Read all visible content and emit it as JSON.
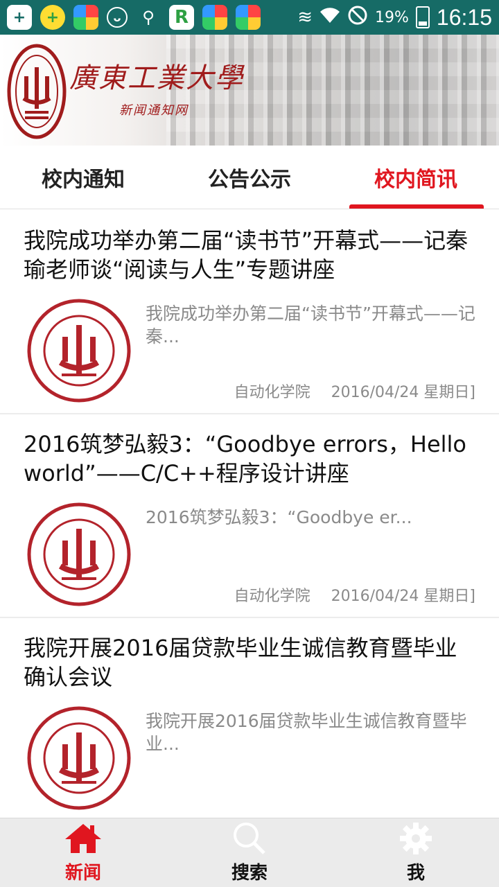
{
  "status_bar": {
    "battery": "19%",
    "time": "16:15",
    "icons": [
      "plus-box-icon",
      "add-icon",
      "app-icon",
      "face-icon",
      "usb-icon",
      "r-app-icon",
      "app-icon",
      "app-icon",
      "vibrate-icon",
      "wifi-icon",
      "no-sign-icon",
      "battery-icon"
    ]
  },
  "header": {
    "title": "廣東工業大學",
    "subtitle": "新闻通知网"
  },
  "tabs": [
    {
      "label": "校内通知",
      "active": false
    },
    {
      "label": "公告公示",
      "active": false
    },
    {
      "label": "校内简讯",
      "active": true
    }
  ],
  "articles": [
    {
      "title": "我院成功举办第二届“读书节”开幕式——记秦瑜老师谈“阅读与人生”专题讲座",
      "summary": "我院成功举办第二届“读书节”开幕式——记秦...",
      "department": "自动化学院",
      "date": "2016/04/24 星期日]"
    },
    {
      "title": "2016筑梦弘毅3：“Goodbye errors，Hello world”——C/C++程序设计讲座",
      "summary": "2016筑梦弘毅3：“Goodbye er...",
      "department": "自动化学院",
      "date": "2016/04/24 星期日]"
    },
    {
      "title": "我院开展2016届贷款毕业生诚信教育暨毕业确认会议",
      "summary": "我院开展2016届贷款毕业生诚信教育暨毕业...",
      "department": "",
      "date": ""
    }
  ],
  "bottom_nav": [
    {
      "label": "新闻",
      "icon": "home-icon",
      "active": true
    },
    {
      "label": "搜索",
      "icon": "search-icon",
      "active": false
    },
    {
      "label": "我",
      "icon": "gear-icon",
      "active": false
    }
  ],
  "colors": {
    "accent": "#e0161f",
    "status_bar": "#166b66",
    "logo_red": "#a01c1c"
  }
}
